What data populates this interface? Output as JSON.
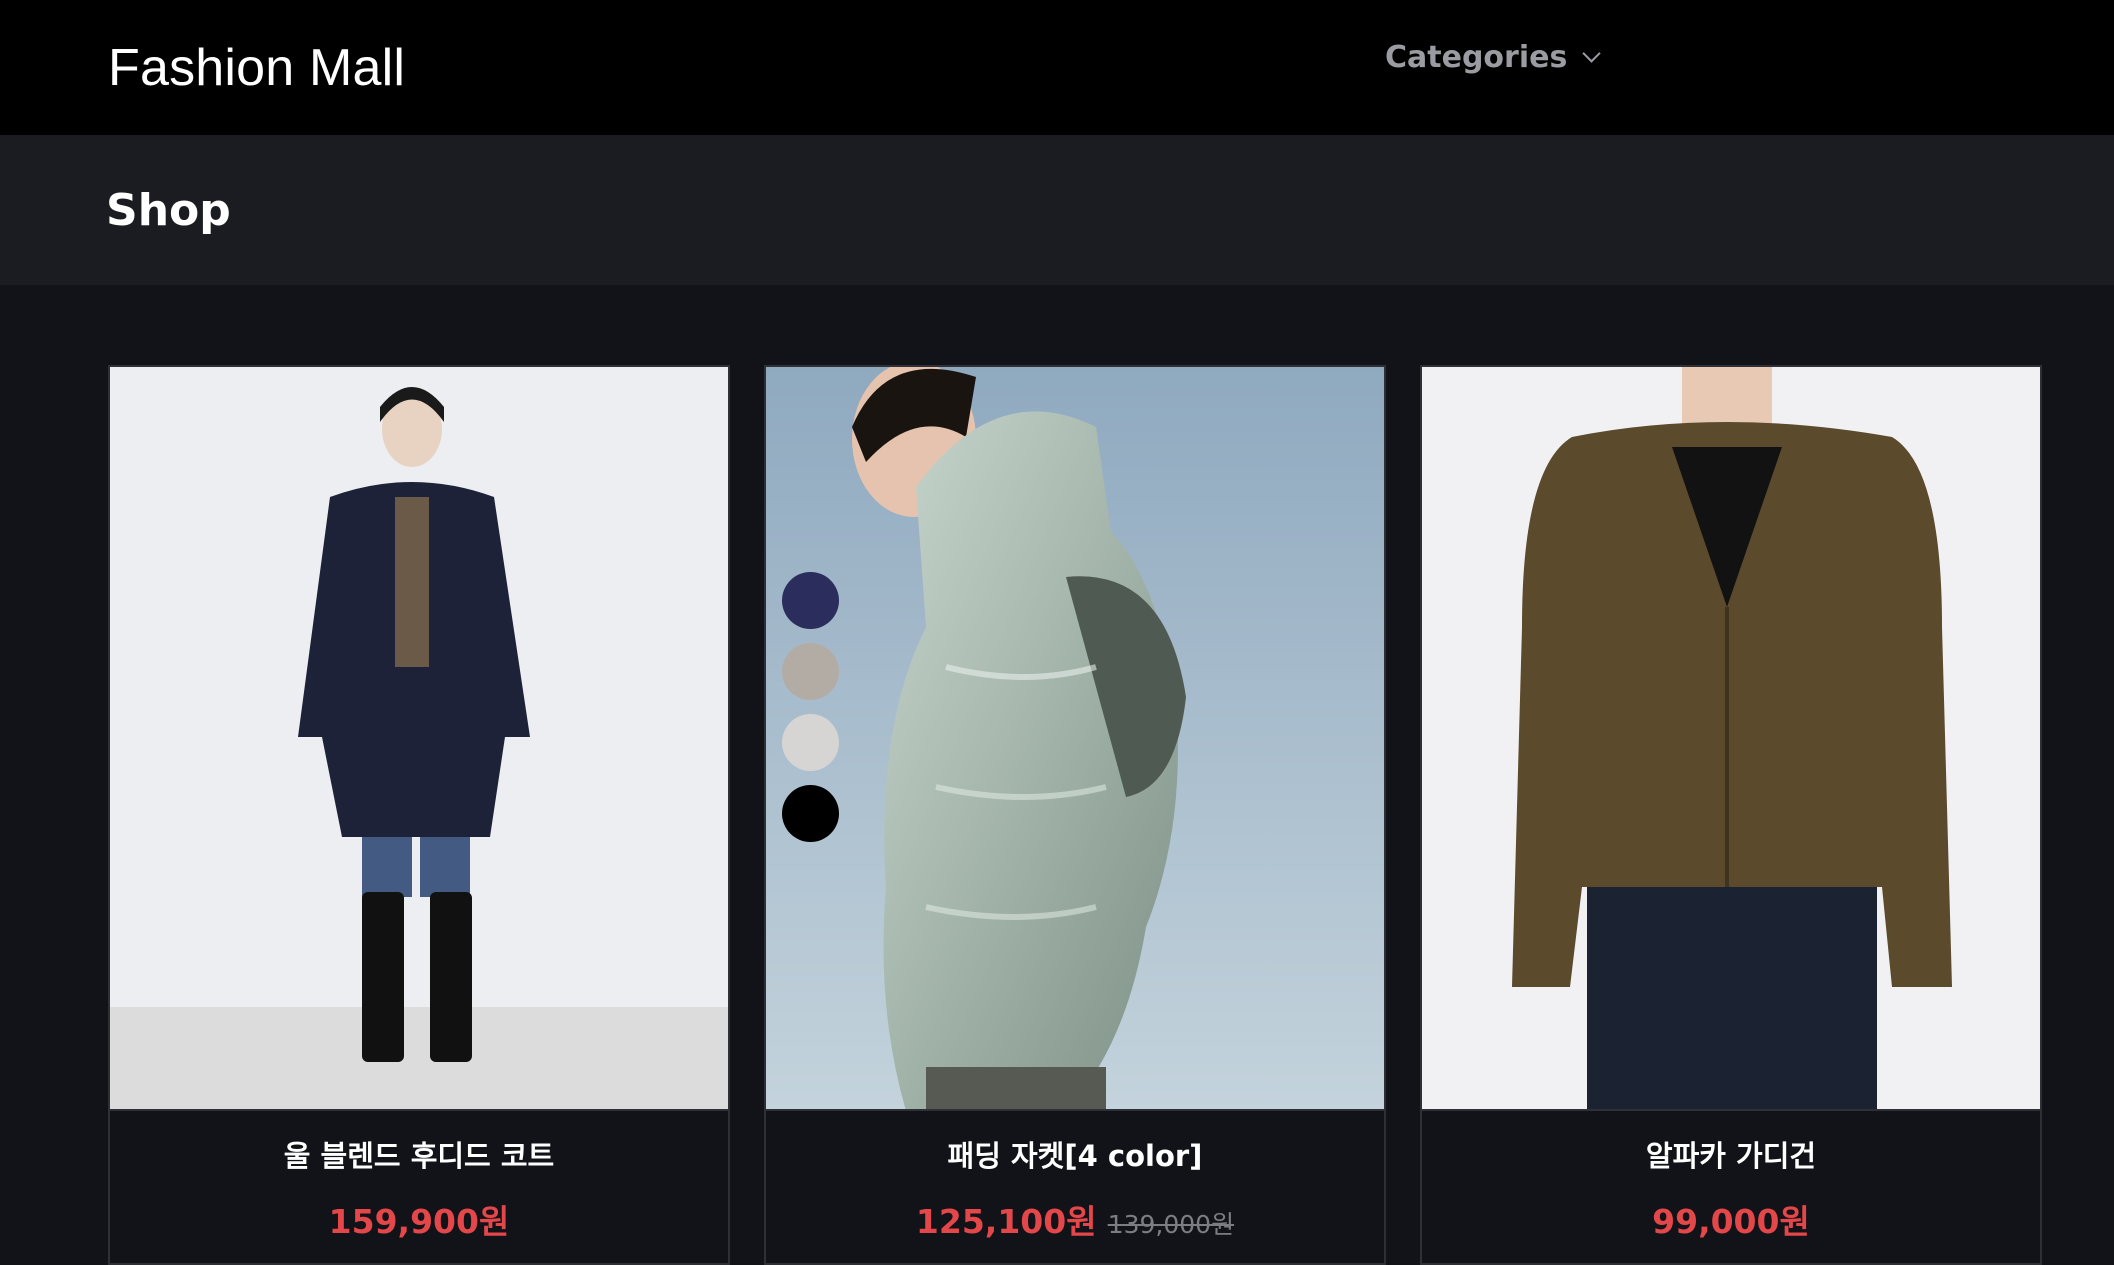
{
  "nav": {
    "brand": "Fashion Mall",
    "categories_label": "Categories"
  },
  "page": {
    "title": "Shop"
  },
  "products": [
    {
      "name": "울 블렌드 후디드 코트",
      "price": "159,900원",
      "original_price": "",
      "image_icon": "hooded-coat-photo"
    },
    {
      "name": "패딩 자켓[4 color]",
      "price": "125,100원",
      "original_price": "139,000원",
      "image_icon": "padded-jacket-photo",
      "swatches": [
        "#2b2d5c",
        "#b3aca4",
        "#d7d5d4",
        "#000000"
      ]
    },
    {
      "name": "알파카 가디건",
      "price": "99,000원",
      "original_price": "",
      "image_icon": "alpaca-cardigan-photo"
    }
  ],
  "colors": {
    "nav_bg": "#000000",
    "header_bg": "#1b1c21",
    "page_bg": "#121318",
    "price": "#e3474a"
  }
}
